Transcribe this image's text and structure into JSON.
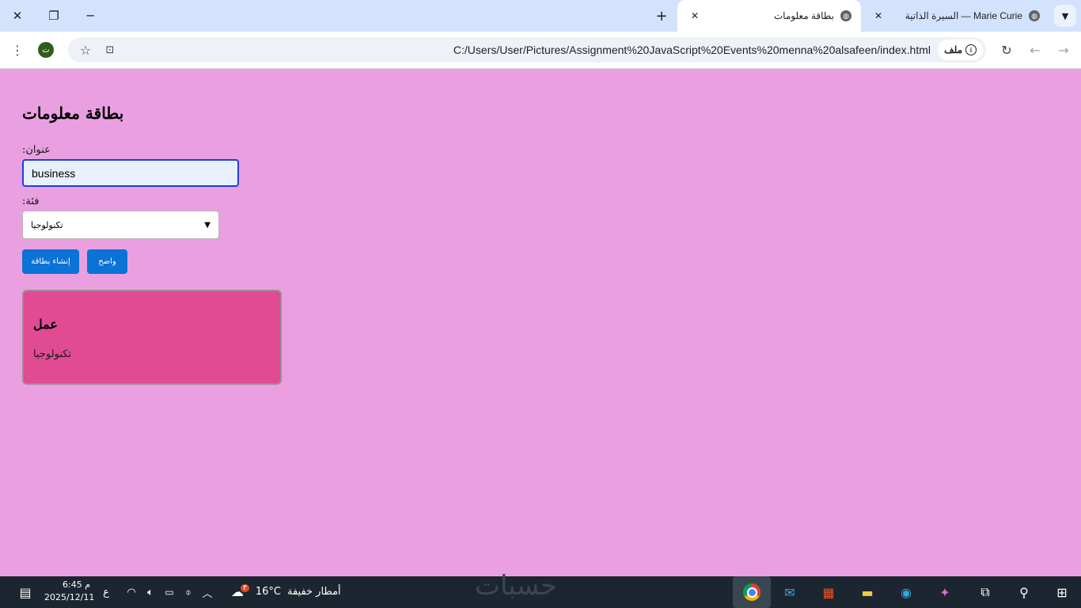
{
  "browser": {
    "tabs": [
      {
        "title": "بطاقة معلومات",
        "active": true
      },
      {
        "title": "Marie Curie — السيرة الذاتية",
        "active": false
      }
    ],
    "url": "C:/Users/User/Pictures/Assignment%20JavaScript%20Events%20menna%20alsafeen/index.html",
    "site_chip": "ملف",
    "profile_initial": "ت"
  },
  "page": {
    "title": "بطاقة معلومات",
    "title_label": "عنوان:",
    "title_value": "business",
    "category_label": "فئة:",
    "category_selected": "تكنولوجيا",
    "create_button": "إنشاء بطاقة",
    "clear_button": "واضح",
    "card": {
      "title": "عمل",
      "category": "تكنولوجيا"
    }
  },
  "taskbar": {
    "time": "6:45 م",
    "date": "2025/12/11",
    "lang": "ع",
    "weather_temp": "16°C",
    "weather_text": "أمطار خفيفة",
    "weather_badge": "٣",
    "watermark": "حسبات"
  },
  "colors": {
    "page_bg": "#eaa0e0",
    "card_bg": "#e04b94",
    "button_bg": "#0b72d6"
  }
}
